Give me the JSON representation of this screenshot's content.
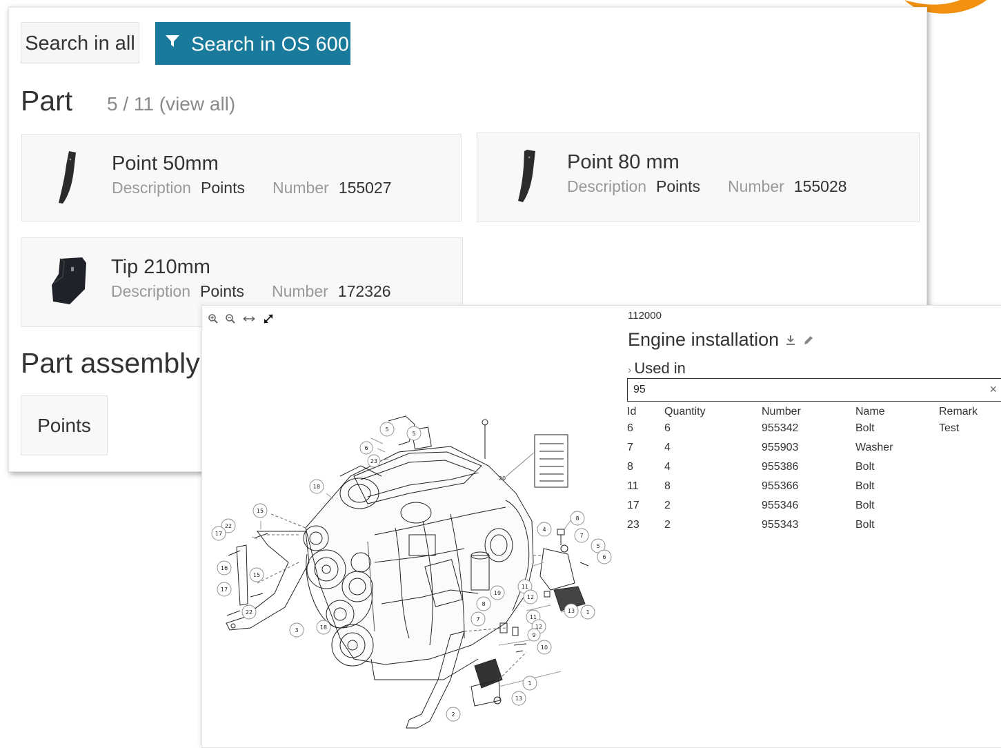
{
  "search": {
    "all_label": "Search in all",
    "filter_label": "Search in OS 600"
  },
  "parts": {
    "heading": "Part",
    "count": "5 / 11 (view all)",
    "items": [
      {
        "title": "Point 50mm",
        "desc_label": "Description",
        "desc": "Points",
        "num_label": "Number",
        "num": "155027",
        "icon": "curved-point-icon"
      },
      {
        "title": "Point 80 mm",
        "desc_label": "Description",
        "desc": "Points",
        "num_label": "Number",
        "num": "155028",
        "icon": "curved-point-icon"
      },
      {
        "title": "Tip 210mm",
        "desc_label": "Description",
        "desc": "Points",
        "num_label": "Number",
        "num": "172326",
        "icon": "tip-block-icon"
      }
    ]
  },
  "assemblies": {
    "heading": "Part assembly",
    "items": [
      "Points"
    ]
  },
  "viewer": {
    "tools": [
      "zoom-in-icon",
      "zoom-out-icon",
      "fit-width-icon",
      "fullscreen-icon"
    ],
    "drawing_icon": "engine-exploded-drawing"
  },
  "assembly": {
    "id": "112000",
    "title": "Engine installation",
    "used_in": "Used in",
    "filter_value": "95",
    "clear": "×",
    "columns": [
      "Id",
      "Quantity",
      "Number",
      "Name",
      "Remark"
    ],
    "rows": [
      {
        "id": "6",
        "qty": "6",
        "num": "955342",
        "name": "Bolt",
        "remark": "Test"
      },
      {
        "id": "7",
        "qty": "4",
        "num": "955903",
        "name": "Washer",
        "remark": ""
      },
      {
        "id": "8",
        "qty": "4",
        "num": "955386",
        "name": "Bolt",
        "remark": ""
      },
      {
        "id": "11",
        "qty": "8",
        "num": "955366",
        "name": "Bolt",
        "remark": ""
      },
      {
        "id": "17",
        "qty": "2",
        "num": "955346",
        "name": "Bolt",
        "remark": ""
      },
      {
        "id": "23",
        "qty": "2",
        "num": "955343",
        "name": "Bolt",
        "remark": ""
      }
    ]
  },
  "callouts": [
    "5",
    "5",
    "6",
    "23",
    "20",
    "18",
    "15",
    "22",
    "17",
    "16",
    "15",
    "17",
    "22",
    "3",
    "18",
    "8",
    "7",
    "2",
    "19",
    "11",
    "12",
    "13",
    "1",
    "4",
    "8",
    "7",
    "5",
    "6",
    "11",
    "12",
    "9",
    "10",
    "1",
    "13"
  ],
  "colors": {
    "accent": "#1a7a9c",
    "brand_orange": "#f29111"
  }
}
